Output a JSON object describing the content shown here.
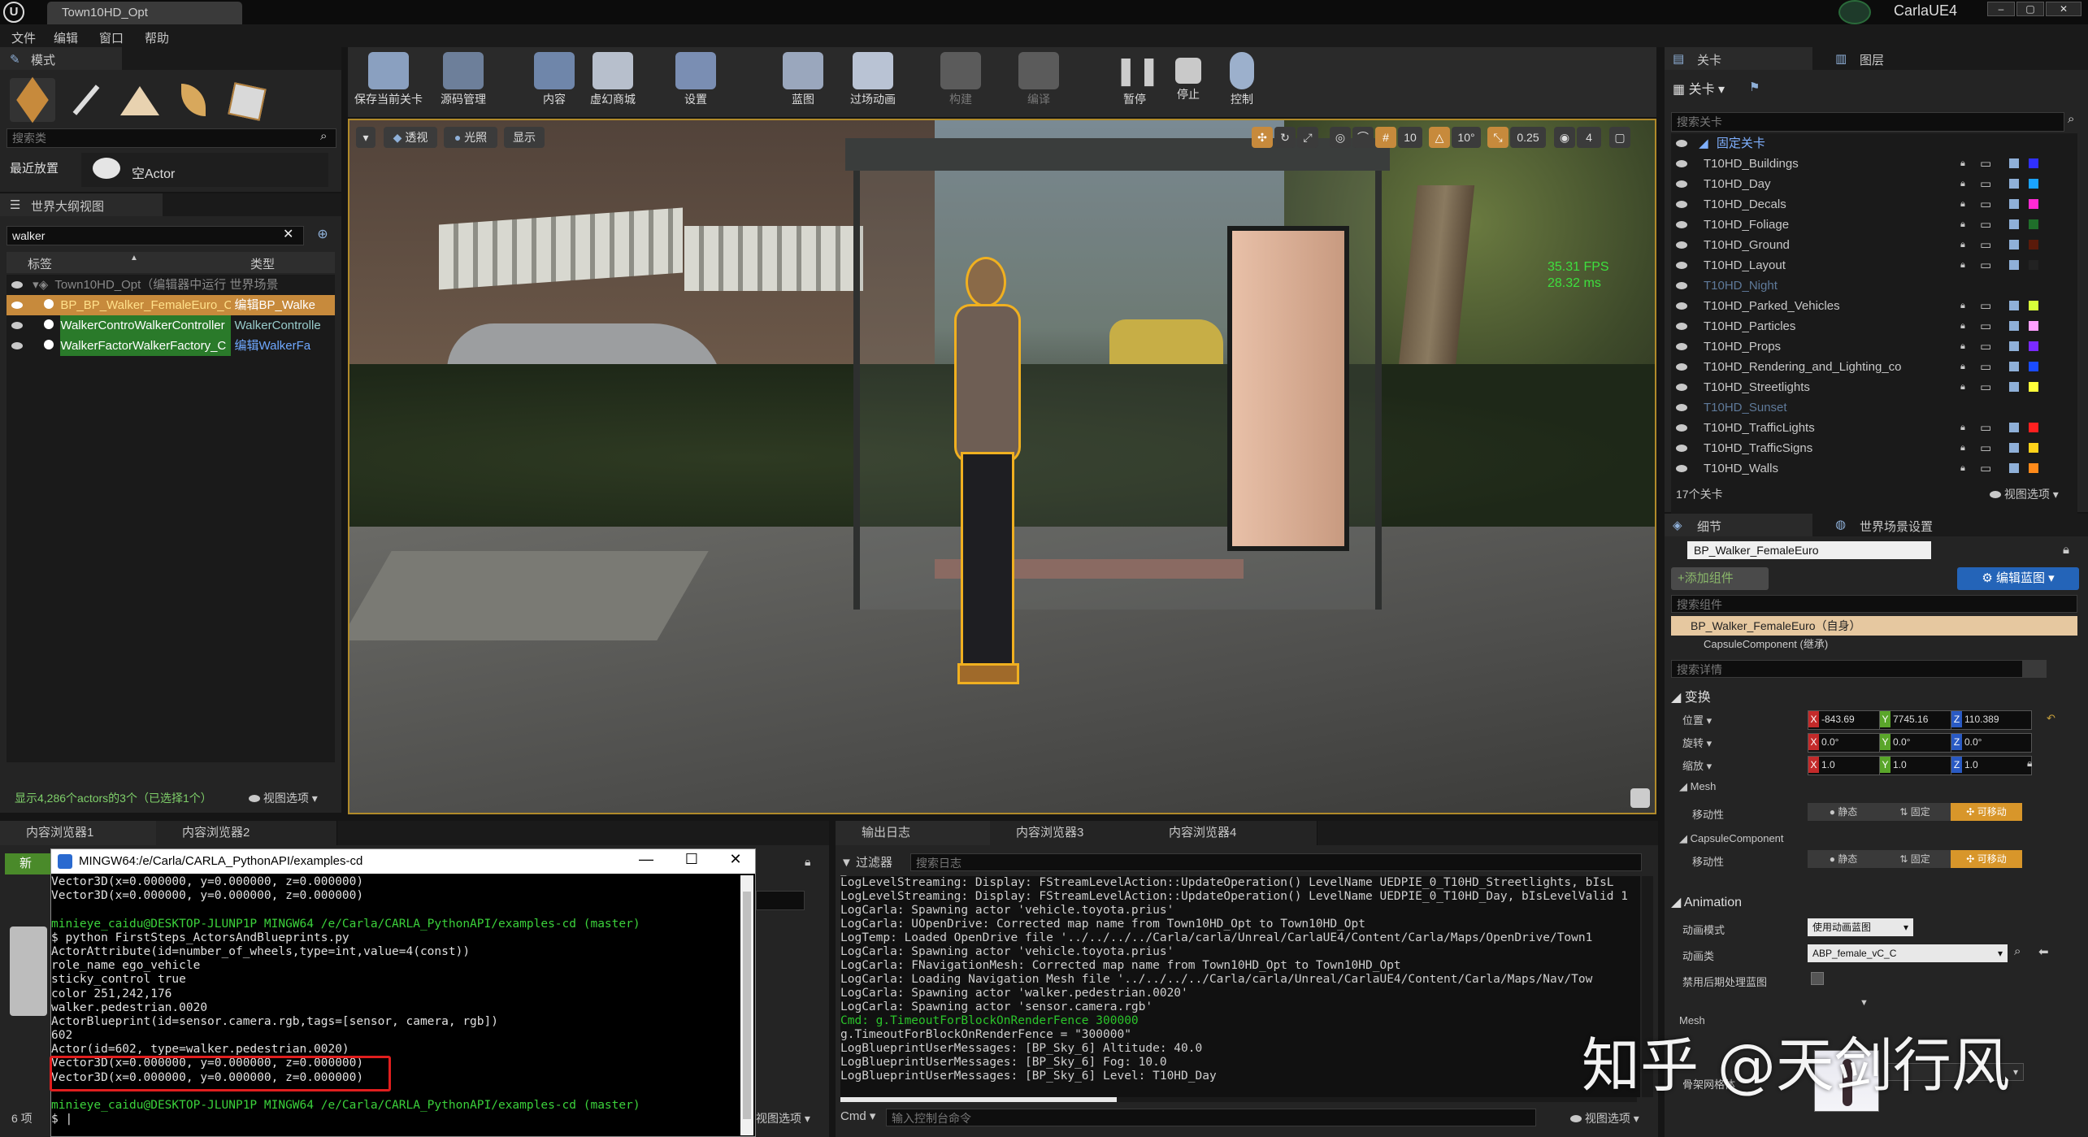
{
  "app": {
    "tab_title": "Town10HD_Opt",
    "project_badge": "CarlaUE4",
    "menu": [
      "文件",
      "编辑",
      "窗口",
      "帮助"
    ]
  },
  "modes": {
    "title": "模式",
    "search_placeholder": "搜索类",
    "recent": "最近放置",
    "empty_actor": "空Actor"
  },
  "outliner": {
    "title": "世界大纲视图",
    "search_value": "walker",
    "col_label": "标签",
    "col_type": "类型",
    "world_row": "Town10HD_Opt（编辑器中运行 世界场景",
    "rows": [
      {
        "label": "BP_BP_Walker_FemaleEuro_C",
        "type": "编辑BP_Walke"
      },
      {
        "label": "WalkerControWalkerController",
        "type": "WalkerControlle"
      },
      {
        "label": "WalkerFactorWalkerFactory_C",
        "type": "编辑WalkerFa"
      }
    ],
    "status": "显示4,286个actors的3个（已选择1个）",
    "view_options": "视图选项"
  },
  "toolbar": {
    "buttons": [
      {
        "label": "保存当前关卡",
        "color": "#8aa0c0"
      },
      {
        "label": "源码管理",
        "color": "#6d7f9a"
      },
      {
        "label": "内容",
        "color": "#6f86aa"
      },
      {
        "label": "虚幻商城",
        "color": "#b7bfcc"
      },
      {
        "label": "设置",
        "color": "#7a8eb3"
      },
      {
        "label": "蓝图",
        "color": "#9aa7bd"
      },
      {
        "label": "过场动画",
        "color": "#b9c3d4"
      },
      {
        "label": "构建",
        "color": "#5b5b5b"
      },
      {
        "label": "编译",
        "color": "#5b5b5b"
      },
      {
        "label": "暂停",
        "color": "#c9c9c9"
      },
      {
        "label": "停止",
        "color": "#c9c9c9"
      },
      {
        "label": "控制",
        "color": "#9cb0cc"
      }
    ]
  },
  "viewport": {
    "btn_perspective": "透视",
    "btn_lit": "光照",
    "btn_show": "显示",
    "grid_snap": "10",
    "rot_snap": "10°",
    "scale_snap": "0.25",
    "cam_speed": "4",
    "fps": "35.31 FPS",
    "ms": "28.32 ms"
  },
  "levels": {
    "tab_levels": "关卡",
    "tab_layers": "图层",
    "dropdown": "关卡",
    "search_placeholder": "搜索关卡",
    "persistent": "固定关卡",
    "items": [
      {
        "name": "T10HD_Buildings",
        "color": "#3030ff"
      },
      {
        "name": "T10HD_Day",
        "color": "#1aa3ff"
      },
      {
        "name": "T10HD_Decals",
        "color": "#ff2ad4"
      },
      {
        "name": "T10HD_Foliage",
        "color": "#1f6f2a"
      },
      {
        "name": "T10HD_Ground",
        "color": "#5a1a0a"
      },
      {
        "name": "T10HD_Layout",
        "color": "#222222"
      },
      {
        "name": "T10HD_Night",
        "color": ""
      },
      {
        "name": "T10HD_Parked_Vehicles",
        "color": "#d7ff3a"
      },
      {
        "name": "T10HD_Particles",
        "color": "#ffa0ff"
      },
      {
        "name": "T10HD_Props",
        "color": "#7a2aff"
      },
      {
        "name": "T10HD_Rendering_and_Lighting_co",
        "color": "#1a4bff"
      },
      {
        "name": "T10HD_Streetlights",
        "color": "#ffff3a"
      },
      {
        "name": "T10HD_Sunset",
        "color": ""
      },
      {
        "name": "T10HD_TrafficLights",
        "color": "#ff2020"
      },
      {
        "name": "T10HD_TrafficSigns",
        "color": "#ffd21a"
      },
      {
        "name": "T10HD_Walls",
        "color": "#ff8a1a"
      }
    ],
    "count": "17个关卡",
    "view_options": "视图选项"
  },
  "details": {
    "tab_details": "细节",
    "tab_world": "世界场景设置",
    "actor_name": "BP_Walker_FemaleEuro",
    "add_component": "+添加组件",
    "edit_blueprint": "编辑蓝图",
    "search_components": "搜索组件",
    "self_row": "BP_Walker_FemaleEuro（自身）",
    "capsule_row": "CapsuleComponent (继承)",
    "search_details": "搜索详情",
    "transform": "变换",
    "location": {
      "label": "位置",
      "x": "-843.69",
      "y": "7745.16",
      "z": "110.389"
    },
    "rotation": {
      "label": "旋转",
      "x": "0.0°",
      "y": "0.0°",
      "z": "0.0°"
    },
    "scale": {
      "label": "缩放",
      "x": "1.0",
      "y": "1.0",
      "z": "1.0"
    },
    "mesh_section": "Mesh",
    "mobility_label": "移动性",
    "static": "静态",
    "fixed": "固定",
    "movable": "可移动",
    "capsule_section": "CapsuleComponent",
    "animation_section": "Animation",
    "anim_mode_label": "动画模式",
    "anim_mode_value": "使用动画蓝图",
    "anim_class_label": "动画类",
    "anim_class_value": "ABP_female_vC_C",
    "disable_post_label": "禁用后期处理蓝图",
    "skeletal_label": "骨架网格体",
    "skeletal_section": "Mesh"
  },
  "content_browser": {
    "tab1": "内容浏览器1",
    "tab2": "内容浏览器2",
    "new": "新",
    "count": "6 项",
    "view_options": "视图选项"
  },
  "terminal": {
    "title": "MINGW64:/e/Carla/CARLA_PythonAPI/examples-cd",
    "lines": [
      {
        "t": "Vector3D(x=0.000000, y=0.000000, z=0.000000)",
        "c": "#e0e0e0"
      },
      {
        "t": "Vector3D(x=0.000000, y=0.000000, z=0.000000)",
        "c": "#e0e0e0"
      },
      {
        "t": "",
        "c": "#e0e0e0"
      },
      {
        "t": "minieye_caidu@DESKTOP-JLUNP1P MINGW64 /e/Carla/CARLA_PythonAPI/examples-cd (master)",
        "c": "#3bd13b"
      },
      {
        "t": "$ python FirstSteps_ActorsAndBlueprints.py",
        "c": "#e0e0e0"
      },
      {
        "t": "ActorAttribute(id=number_of_wheels,type=int,value=4(const))",
        "c": "#e0e0e0"
      },
      {
        "t": "role_name ego_vehicle",
        "c": "#e0e0e0"
      },
      {
        "t": "sticky_control true",
        "c": "#e0e0e0"
      },
      {
        "t": "color 251,242,176",
        "c": "#e0e0e0"
      },
      {
        "t": "walker.pedestrian.0020",
        "c": "#e0e0e0"
      },
      {
        "t": "ActorBlueprint(id=sensor.camera.rgb,tags=[sensor, camera, rgb])",
        "c": "#e0e0e0"
      },
      {
        "t": "602",
        "c": "#e0e0e0"
      },
      {
        "t": "Actor(id=602, type=walker.pedestrian.0020)",
        "c": "#e0e0e0"
      },
      {
        "t": "Vector3D(x=0.000000, y=0.000000, z=0.000000)",
        "c": "#e0e0e0"
      },
      {
        "t": "Vector3D(x=0.000000, y=0.000000, z=0.000000)",
        "c": "#e0e0e0"
      },
      {
        "t": "",
        "c": "#e0e0e0"
      },
      {
        "t": "minieye_caidu@DESKTOP-JLUNP1P MINGW64 /e/Carla/CARLA_PythonAPI/examples-cd (master)",
        "c": "#3bd13b"
      },
      {
        "t": "$ |",
        "c": "#e0e0e0"
      }
    ]
  },
  "output_log": {
    "tab": "输出日志",
    "tab3": "内容浏览器3",
    "tab4": "内容浏览器4",
    "filter": "过滤器",
    "search_placeholder": "搜索日志",
    "lines": [
      {
        "t": "LogLevelStreaming: Display: FStreamLevelAction::UpdateOperation() LevelName UEDPIE_0_T10HD_Streetlights, bIsL",
        "c": "#cfcfcf"
      },
      {
        "t": "LogLevelStreaming: Display: FStreamLevelAction::UpdateOperation() LevelName UEDPIE_0_T10HD_Day, bIsLevelValid 1",
        "c": "#cfcfcf"
      },
      {
        "t": "LogCarla: Spawning actor 'vehicle.toyota.prius'",
        "c": "#cfcfcf"
      },
      {
        "t": "LogCarla: UOpenDrive: Corrected map name from Town10HD_Opt to Town10HD_Opt",
        "c": "#cfcfcf"
      },
      {
        "t": "LogTemp: Loaded OpenDrive file '../../../../Carla/carla/Unreal/CarlaUE4/Content/Carla/Maps/OpenDrive/Town1",
        "c": "#cfcfcf"
      },
      {
        "t": "LogCarla: Spawning actor 'vehicle.toyota.prius'",
        "c": "#cfcfcf"
      },
      {
        "t": "LogCarla: FNavigationMesh: Corrected map name from Town10HD_Opt to Town10HD_Opt",
        "c": "#cfcfcf"
      },
      {
        "t": "LogCarla: Loading Navigation Mesh file '../../../../Carla/carla/Unreal/CarlaUE4/Content/Carla/Maps/Nav/Tow",
        "c": "#cfcfcf"
      },
      {
        "t": "LogCarla: Spawning actor 'walker.pedestrian.0020'",
        "c": "#cfcfcf"
      },
      {
        "t": "LogCarla: Spawning actor 'sensor.camera.rgb'",
        "c": "#cfcfcf"
      },
      {
        "t": "Cmd: g.TimeoutForBlockOnRenderFence 300000",
        "c": "#2bc42b"
      },
      {
        "t": "g.TimeoutForBlockOnRenderFence = \"300000\"",
        "c": "#cfcfcf"
      },
      {
        "t": "LogBlueprintUserMessages: [BP_Sky_6] Altitude: 40.0",
        "c": "#cfcfcf"
      },
      {
        "t": "LogBlueprintUserMessages: [BP_Sky_6] Fog: 10.0",
        "c": "#cfcfcf"
      },
      {
        "t": "LogBlueprintUserMessages: [BP_Sky_6] Level: T10HD_Day",
        "c": "#cfcfcf"
      }
    ],
    "cmd_label": "Cmd",
    "cmd_placeholder": "输入控制台命令",
    "view_options": "视图选项"
  },
  "watermark": "知乎 @天剑行风"
}
